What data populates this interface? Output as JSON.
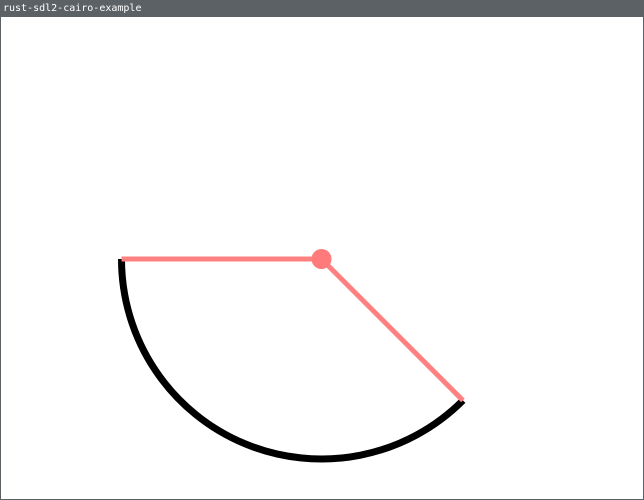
{
  "window": {
    "title": "rust-sdl2-cairo-example"
  },
  "colors": {
    "titlebar_bg": "#5c6166",
    "titlebar_text": "#ffffff",
    "canvas_bg": "#ffffff",
    "arc_stroke": "#000000",
    "guide_stroke": "#ff8080",
    "center_dot": "#ff7a7a"
  },
  "drawing": {
    "arc_start_angle_deg": 45,
    "arc_end_angle_deg": 180,
    "guide_lines_visible": true,
    "center_marker_visible": true
  }
}
